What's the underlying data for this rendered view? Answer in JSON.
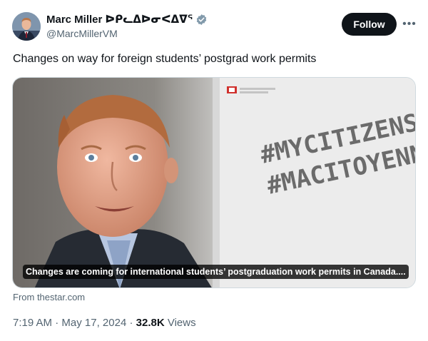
{
  "author": {
    "display_name": "Marc Miller ᐅᑭᓚᐃᐅᓂᐸᐃᐁᕐ",
    "handle": "@MarcMillerVM",
    "verified": true
  },
  "follow_label": "Follow",
  "more_icon": "more-horizontal-icon",
  "tweet_text": "Changes on way for foreign students’ postgrad work permits",
  "media": {
    "caption": "Changes are coming for international students’ postgraduation work permits in Canada....",
    "banner_line1": "#MYCITIZENSHIP",
    "banner_line2": "#MACITOYENNETÉ",
    "source_label": "From thestar.com"
  },
  "meta": {
    "time": "7:19 AM",
    "separator": " · ",
    "date": "May 17, 2024",
    "views_count": "32.8K",
    "views_label": "Views"
  },
  "colors": {
    "text_primary": "#0f1419",
    "text_secondary": "#536471",
    "verified": "#829aab",
    "follow_bg": "#0f1419"
  }
}
